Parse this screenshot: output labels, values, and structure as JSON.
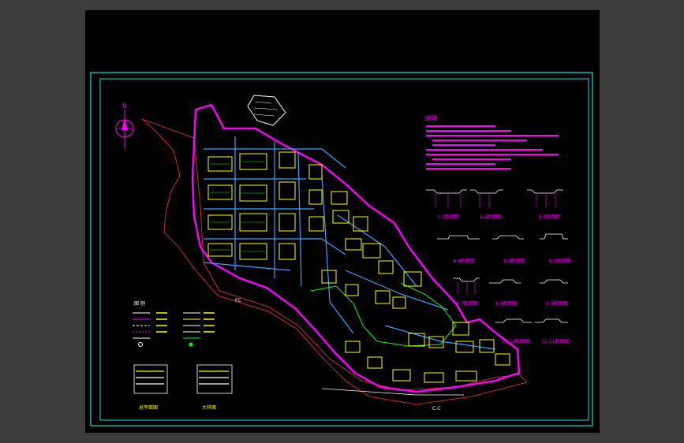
{
  "notes": {
    "heading": "说明"
  },
  "site": {
    "north_arrow_label": "N",
    "road_label_1": "C-C",
    "road_label_2": "FC"
  },
  "section_labels": [
    "1-1断面图",
    "2-2断面图",
    "3-3断面图",
    "4-4断面图",
    "5-5断面图",
    "6-6断面图",
    "7-7断面图",
    "8-8断面图",
    "9-9断面图",
    "10-10断面图",
    "11-11断面图"
  ],
  "legend": {
    "title_left": "图 例",
    "caption_left": "总平面图",
    "caption_right": "大样图"
  },
  "colors": {
    "frame_cyan": "#00e5e5",
    "magenta": "#ff00ff",
    "yellow": "#ffff00",
    "green": "#00ff00",
    "white": "#ffffff",
    "background": "#000000",
    "workspace": "#3c3c3c"
  }
}
